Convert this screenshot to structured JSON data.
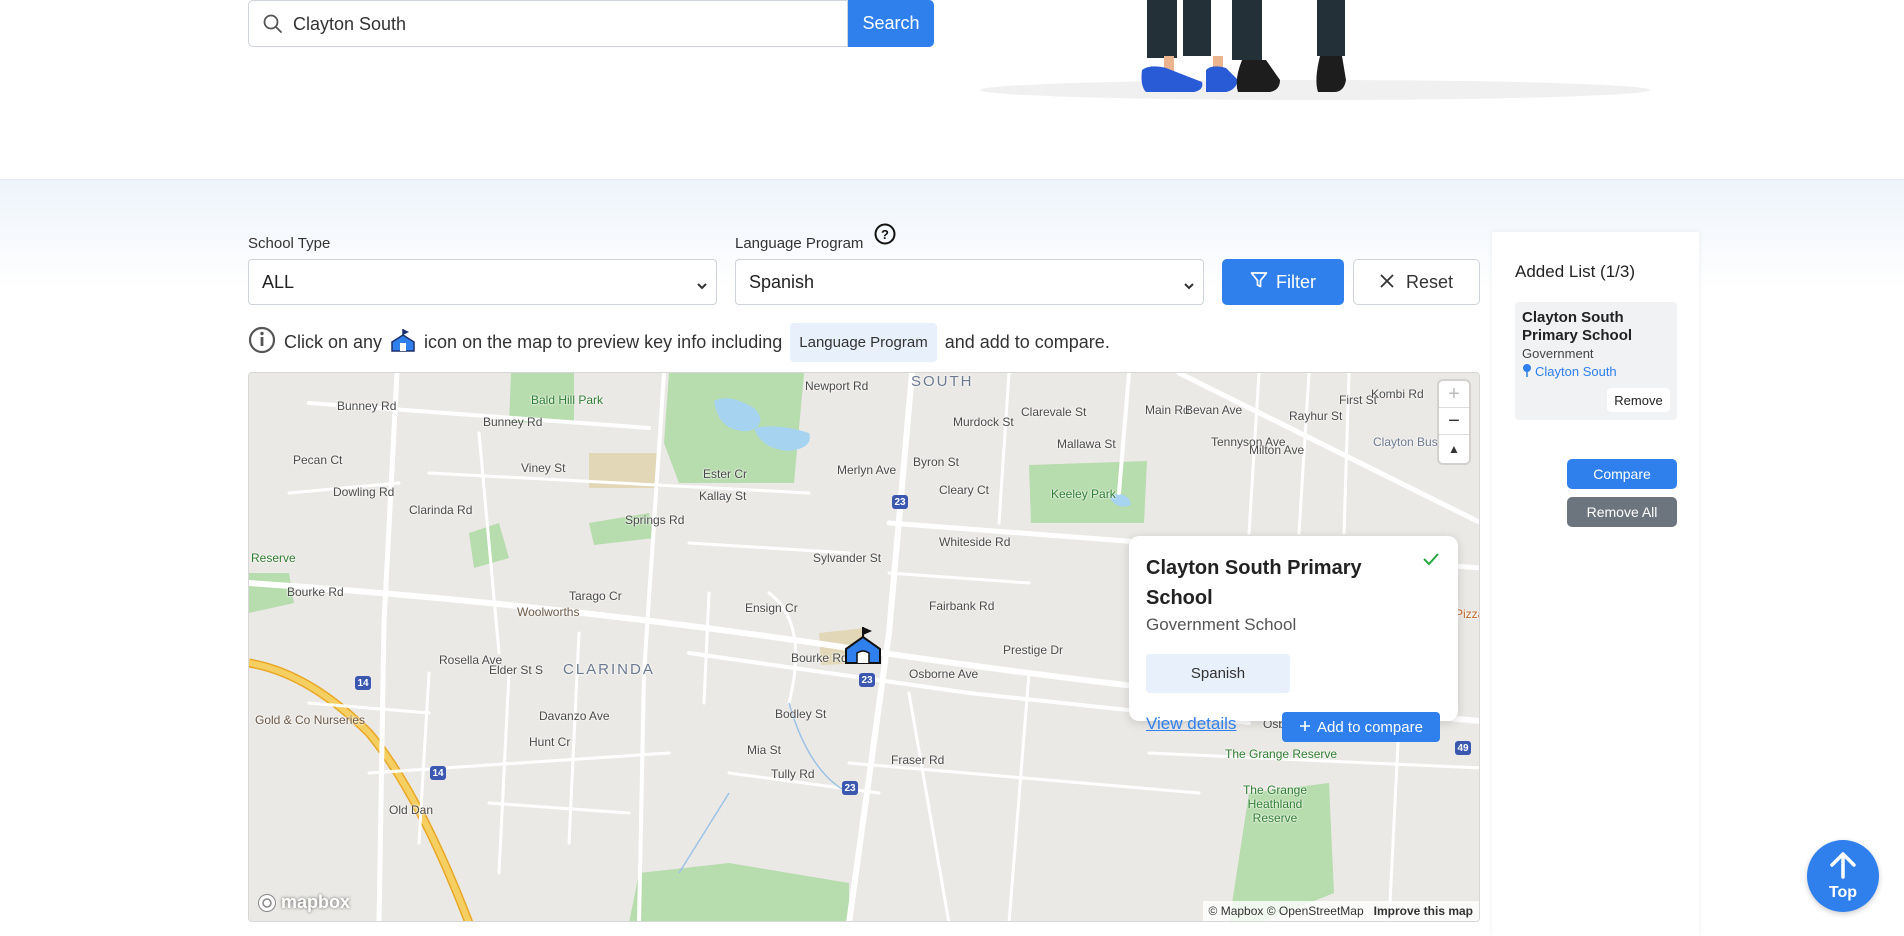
{
  "search": {
    "value": "Clayton South",
    "placeholder": "Search",
    "button_label": "Search"
  },
  "filters": {
    "school_type_label": "School Type",
    "school_type_value": "ALL",
    "language_program_label": "Language Program",
    "language_program_value": "Spanish",
    "help_icon": "question-circle-icon",
    "filter_label": "Filter",
    "reset_label": "Reset"
  },
  "hint": {
    "prefix": "Click on any",
    "middle": "icon on the map to preview key info including",
    "badge": "Language Program",
    "suffix": "and add to compare."
  },
  "map": {
    "suburb_labels": [
      "SOUTH",
      "CLARINDA"
    ],
    "roads": [
      "Newport Rd",
      "Bunney Rd",
      "Bunney Rd",
      "Pecan Ct",
      "Dowling Rd",
      "Viney St",
      "Clarinda Rd",
      "Springs Rd",
      "Ester Cr",
      "Kallay St",
      "Merlyn Ave",
      "Byron St",
      "Murdock St",
      "Clarevale St",
      "Mallawa St",
      "Main Rd",
      "Bevan Ave",
      "Tennyson Ave",
      "Milton Ave",
      "Rayhur St",
      "First St",
      "Kombi Rd",
      "Cleary Ct",
      "Whiteside Rd",
      "Sylvander St",
      "Fairbank Rd",
      "Bourke Rd",
      "Bourke Rd",
      "Tarago Cr",
      "Ensign Cr",
      "Osborne Ave",
      "Prestige Dr",
      "Rosella Ave",
      "Elder St S",
      "Davanzo Ave",
      "Bodley St",
      "Hunt Cr",
      "Mia St",
      "Fraser Rd",
      "Tully Rd",
      "Osborne Ave",
      "Old Dan"
    ],
    "places": [
      "Bald Hill Park",
      "Keeley Park",
      "Woolworths",
      "Reserve",
      "Gold & Co Nurseries",
      "The Grange Reserve",
      "The Grange Heathland Reserve",
      "Clayton Bus",
      "Pizza"
    ],
    "shields": [
      "23",
      "23",
      "23",
      "14",
      "14",
      "49"
    ],
    "zoom_in": "+",
    "zoom_out": "−",
    "compass": "▲",
    "logo": "mapbox",
    "attribution": "© Mapbox © OpenStreetMap",
    "improve": "Improve this map"
  },
  "popup": {
    "title": "Clayton South Primary School",
    "subtitle": "Government School",
    "language": "Spanish",
    "view_details": "View details",
    "add_compare": "Add to compare"
  },
  "added_list": {
    "title": "Added List (1/3)",
    "items": [
      {
        "name": "Clayton South Primary School",
        "type": "Government",
        "location": "Clayton South",
        "remove": "Remove"
      }
    ],
    "compare_label": "Compare",
    "remove_all_label": "Remove All"
  },
  "top_button": {
    "label": "Top"
  },
  "colors": {
    "primary": "#2f80ed",
    "secondary": "#6c757d",
    "park": "#b7dcae",
    "highway": "#f2c14e"
  }
}
